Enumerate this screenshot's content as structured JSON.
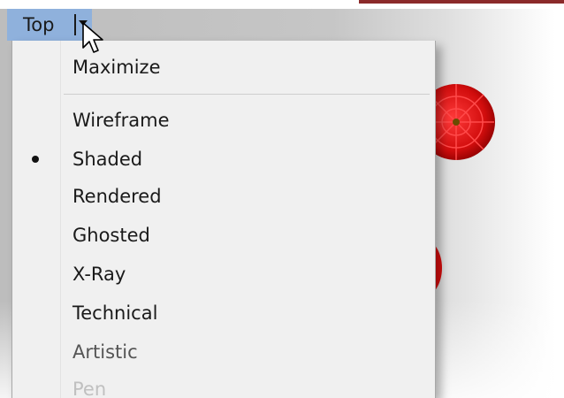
{
  "viewport": {
    "name": "Top",
    "dropdown_icon": "chevron-down-icon",
    "accent_color": "#8fb1dc"
  },
  "menu": {
    "items": [
      {
        "label": "Maximize",
        "selected": false,
        "state": "normal"
      },
      {
        "label": "Wireframe",
        "selected": false,
        "state": "normal"
      },
      {
        "label": "Shaded",
        "selected": true,
        "state": "normal"
      },
      {
        "label": "Rendered",
        "selected": false,
        "state": "normal"
      },
      {
        "label": "Ghosted",
        "selected": false,
        "state": "normal"
      },
      {
        "label": "X-Ray",
        "selected": false,
        "state": "normal"
      },
      {
        "label": "Technical",
        "selected": false,
        "state": "normal"
      },
      {
        "label": "Artistic",
        "selected": false,
        "state": "dim"
      },
      {
        "label": "Pen",
        "selected": false,
        "state": "disabled"
      }
    ]
  },
  "scene": {
    "object_color": "#e01414",
    "cursor_icon": "mouse-pointer-icon"
  }
}
